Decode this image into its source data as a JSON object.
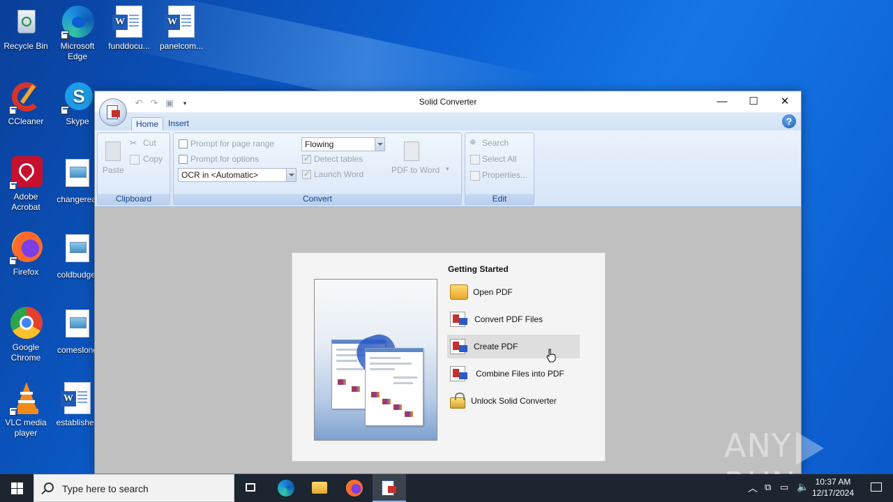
{
  "desktop": {
    "icons": [
      {
        "label": "Recycle Bin"
      },
      {
        "label": "Microsoft Edge"
      },
      {
        "label": "funddocu..."
      },
      {
        "label": "panelcom..."
      },
      {
        "label": "CCleaner"
      },
      {
        "label": "Skype"
      },
      {
        "label": "Adobe Acrobat"
      },
      {
        "label": "changereal"
      },
      {
        "label": "Firefox"
      },
      {
        "label": "coldbudget"
      },
      {
        "label": "Google Chrome"
      },
      {
        "label": "comeslong"
      },
      {
        "label": "VLC media player"
      },
      {
        "label": "established"
      }
    ]
  },
  "window": {
    "title": "Solid Converter",
    "controls": {
      "minimize": "—",
      "maximize": "☐",
      "close": "✕"
    },
    "tabs": [
      "Home",
      "Insert"
    ],
    "help": "?",
    "ribbon": {
      "clipboard": {
        "label": "Clipboard",
        "paste": "Paste",
        "cut": "Cut",
        "copy": "Copy"
      },
      "convert": {
        "label": "Convert",
        "prompt_page_range": "Prompt for page range",
        "prompt_options": "Prompt for options",
        "ocr_value": "OCR in <Automatic>",
        "layout_value": "Flowing",
        "detect_tables": "Detect tables",
        "launch_word": "Launch Word",
        "pdf_to_word": "PDF to Word"
      },
      "edit": {
        "label": "Edit",
        "search": "Search",
        "select_all": "Select All",
        "properties": "Properties..."
      }
    }
  },
  "getting_started": {
    "title": "Getting Started",
    "items": [
      {
        "label": "Open PDF"
      },
      {
        "label": "Convert PDF Files"
      },
      {
        "label": "Create PDF"
      },
      {
        "label": "Combine Files into PDF"
      },
      {
        "label": "Unlock Solid Converter"
      }
    ]
  },
  "watermark": {
    "left": "ANY",
    "right": "RUN"
  },
  "taskbar": {
    "search_placeholder": "Type here to search",
    "time": "10:37 AM",
    "date": "12/17/2024"
  }
}
